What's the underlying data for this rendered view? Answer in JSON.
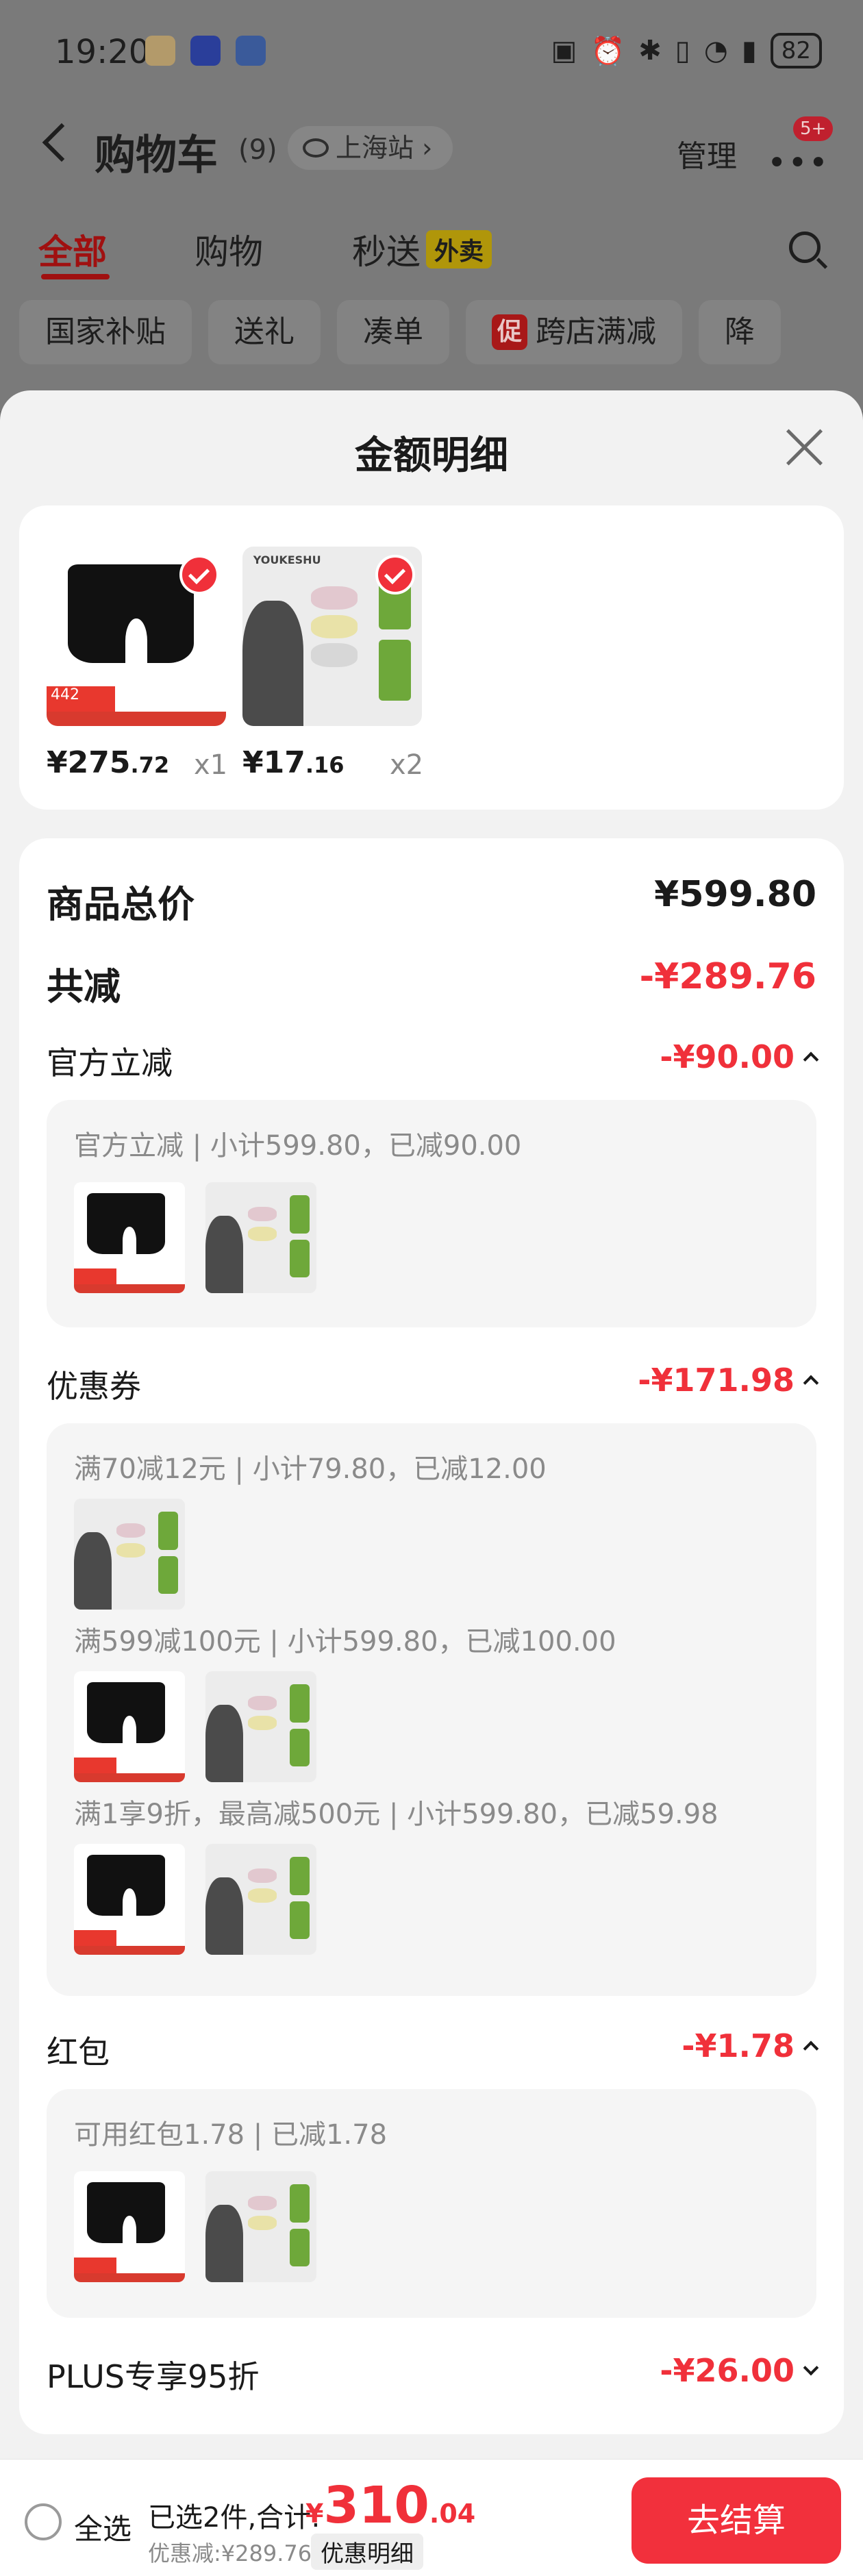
{
  "status_bar": {
    "time": "19:20",
    "battery": "82"
  },
  "header": {
    "title": "购物车",
    "count": "(9)",
    "station": "上海站",
    "station_arrow": "›",
    "manage": "管理",
    "more_badge": "5+"
  },
  "tabs": [
    {
      "label": "全部",
      "active": true
    },
    {
      "label": "购物"
    },
    {
      "label": "秒送"
    }
  ],
  "tab_badge": "外卖",
  "chips": [
    {
      "label": "国家补贴"
    },
    {
      "label": "送礼"
    },
    {
      "label": "凑单"
    },
    {
      "label": "跨店满减",
      "tag": "促"
    },
    {
      "label": "降"
    }
  ],
  "sheet": {
    "title": "金额明细",
    "selected_items": [
      {
        "icon": "briefs-product-image",
        "price_int": "¥275",
        "price_dec": ".72",
        "qty": "x1",
        "tag": "442"
      },
      {
        "icon": "socks-product-image",
        "price_int": "¥17",
        "price_dec": ".16",
        "qty": "x2",
        "brand": "YOUKESHU"
      }
    ]
  },
  "detail": {
    "total_label": "商品总价",
    "total_value": "¥599.80",
    "reduce_label": "共减",
    "reduce_value": "-¥289.76",
    "official": {
      "label": "官方立减",
      "value": "-¥90.00",
      "line": "官方立减 | 小计599.80，已减90.00"
    },
    "coupon": {
      "label": "优惠券",
      "value": "-¥171.98",
      "lines": [
        "满70减12元 | 小计79.80，已减12.00",
        "满599减100元 | 小计599.80，已减100.00",
        "满1享9折，最高减500元 | 小计599.80，已减59.98"
      ]
    },
    "hongbao": {
      "label": "红包",
      "value": "-¥1.78",
      "line": "可用红包1.78 | 已减1.78"
    },
    "plus": {
      "label": "PLUS专享95折",
      "value": "-¥26.00"
    }
  },
  "bottom_bar": {
    "select_all": "全选",
    "selected_text": "已选2件,合计:",
    "price_yen": "¥",
    "price_int": "310",
    "price_dec": ".04",
    "discount": "优惠减:¥289.76",
    "detail_link": "优惠明细",
    "checkout": "去结算"
  },
  "colors": {
    "accent_red": "#f0303a",
    "overlay_gray": "#7a7a7a",
    "sheet_bg": "#f2f2f2"
  }
}
